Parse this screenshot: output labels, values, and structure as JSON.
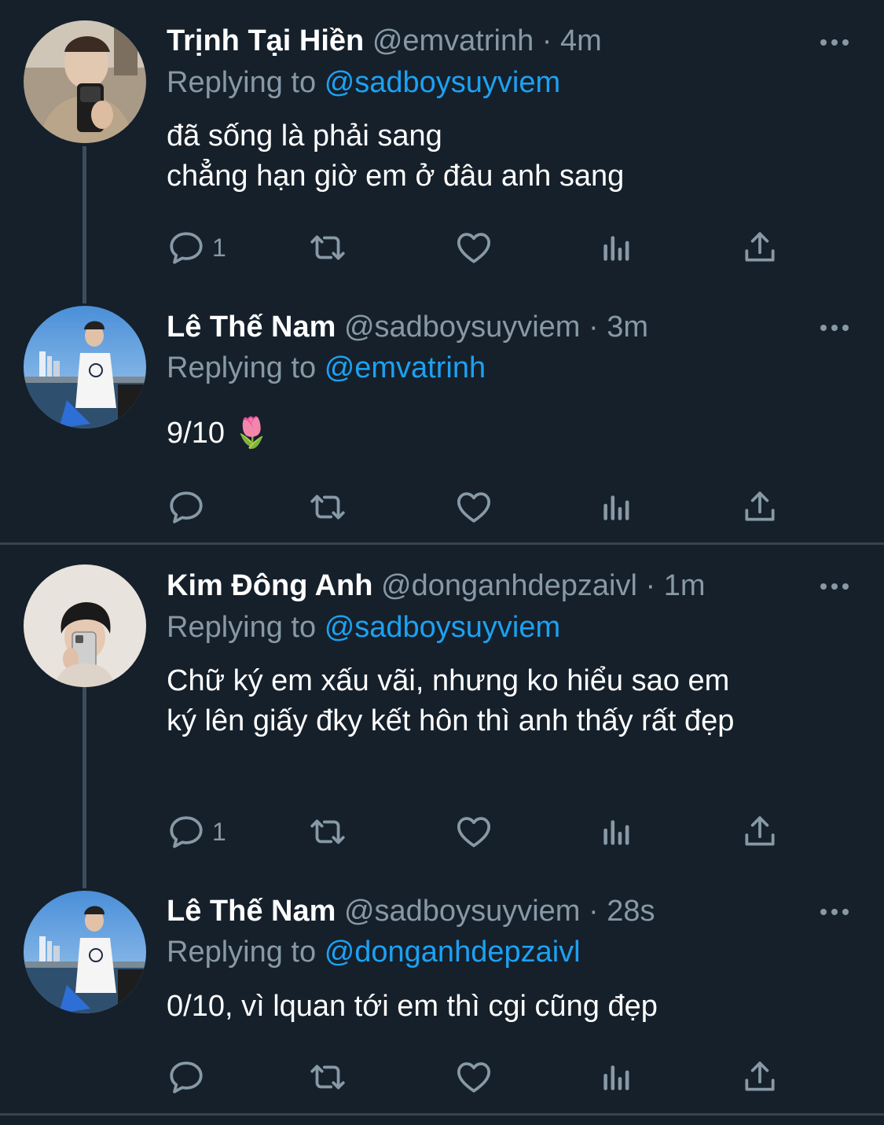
{
  "tweets": [
    {
      "name": "Trịnh Tại Hiền",
      "handle": "@emvatrinh",
      "dot": "·",
      "time": "4m",
      "replying_prefix": "Replying to",
      "replying_to": "@sadboysuyviem",
      "text_lines": [
        "đã sống là phải sang",
        "chẳng hạn giờ em ở đâu anh sang"
      ],
      "reply_count": "1",
      "avatar_icon": "avatar-photo"
    },
    {
      "name": "Lê Thế Nam",
      "handle": "@sadboysuyviem",
      "dot": "·",
      "time": "3m",
      "replying_prefix": "Replying to",
      "replying_to": "@emvatrinh",
      "text_lines": [
        "9/10 🌷"
      ],
      "reply_count": "",
      "avatar_icon": "avatar-photo"
    },
    {
      "name": "Kim Đông Anh",
      "handle": "@donganhdepzaivl",
      "dot": "·",
      "time": "1m",
      "replying_prefix": "Replying to",
      "replying_to": "@sadboysuyviem",
      "text_lines": [
        "Chữ ký em xấu vãi, nhưng ko hiểu sao em",
        "ký lên giấy đky kết hôn thì anh thấy rất đẹp"
      ],
      "reply_count": "1",
      "avatar_icon": "avatar-photo"
    },
    {
      "name": "Lê Thế Nam",
      "handle": "@sadboysuyviem",
      "dot": "·",
      "time": "28s",
      "replying_prefix": "Replying to",
      "replying_to": "@donganhdepzaivl",
      "text_lines": [
        "0/10, vì lquan tới em thì cgi cũng đẹp"
      ],
      "reply_count": "",
      "avatar_icon": "avatar-photo"
    }
  ],
  "colors": {
    "background": "#15202b",
    "text_primary": "#ffffff",
    "text_secondary": "#8899a6",
    "link": "#1da1f2",
    "divider": "#38444d"
  },
  "icons": {
    "reply": "reply-icon",
    "retweet": "retweet-icon",
    "like": "heart-icon",
    "analytics": "analytics-icon",
    "share": "share-icon",
    "more": "more-dots-icon"
  }
}
